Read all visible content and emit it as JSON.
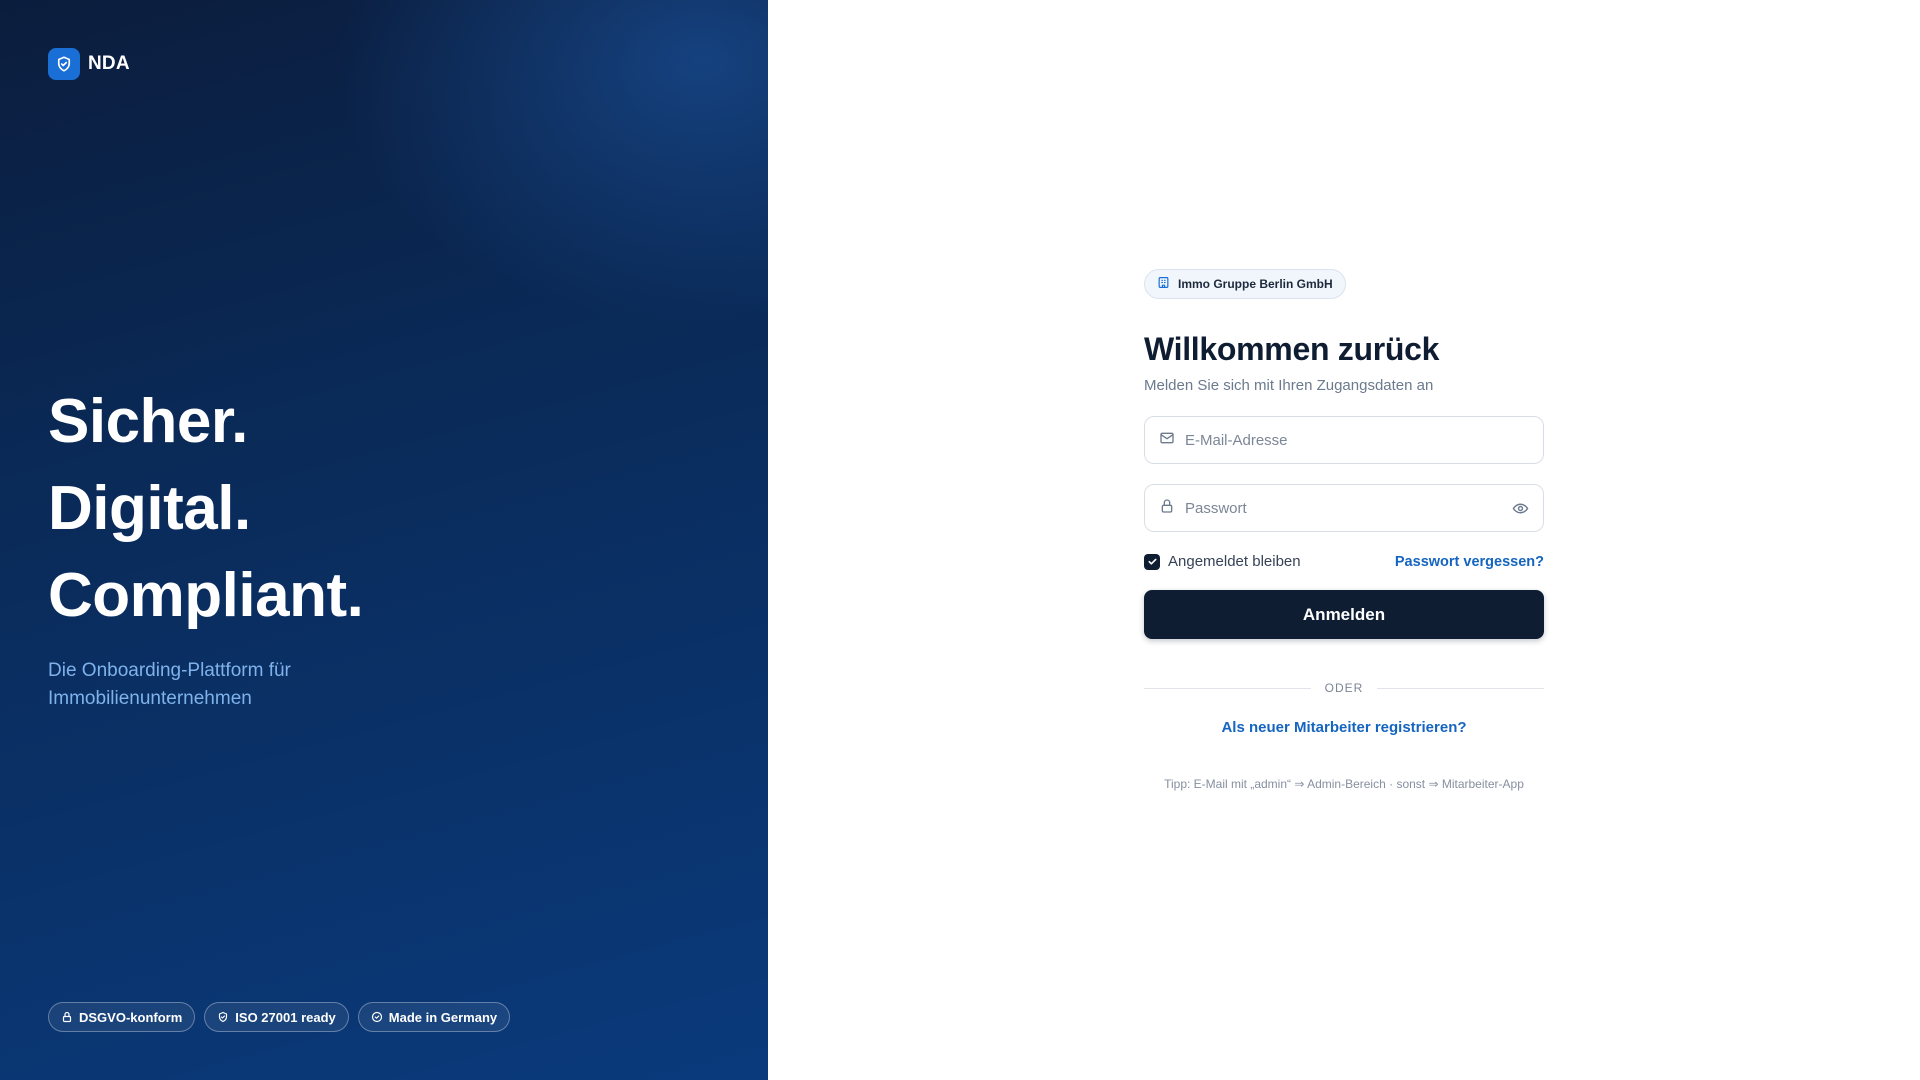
{
  "brand": {
    "name": "NDA",
    "logo_icon": "shield-check-icon",
    "accent": "#1a6fd6"
  },
  "hero": {
    "lines": [
      "Sicher.",
      "Digital.",
      "Compliant."
    ],
    "subtitle": "Die Onboarding-Plattform für Immobilienunternehmen"
  },
  "badges": [
    {
      "label": "DSGVO-konform",
      "icon": "lock-icon"
    },
    {
      "label": "ISO 27001 ready",
      "icon": "shield-icon"
    },
    {
      "label": "Made in Germany",
      "icon": "check-circle-icon"
    }
  ],
  "login": {
    "organization": "Immo Gruppe Berlin GmbH",
    "organization_icon": "building-icon",
    "title": "Willkommen zurück",
    "subtitle": "Melden Sie sich mit Ihren Zugangsdaten an",
    "email": {
      "placeholder": "E-Mail-Adresse",
      "value": "",
      "icon": "mail-icon"
    },
    "password": {
      "placeholder": "Passwort",
      "value": "",
      "icon": "lock-icon",
      "toggle_icon": "eye-icon"
    },
    "remember_label": "Angemeldet bleiben",
    "remember_checked": true,
    "forgot_label": "Passwort vergessen?",
    "submit_label": "Anmelden",
    "divider_label": "ODER",
    "register_label": "Als neuer Mitarbeiter registrieren?",
    "tip": "Tipp: E-Mail mit „admin“ ⇒ Admin-Bereich · sonst ⇒ Mitarbeiter-App"
  },
  "colors": {
    "primary_dark": "#0f1d33",
    "link": "#1565c0",
    "hero_subtitle": "#7fb2ec",
    "panel_dark": "#0b1d3d",
    "panel_blue": "#0a3a7c"
  }
}
